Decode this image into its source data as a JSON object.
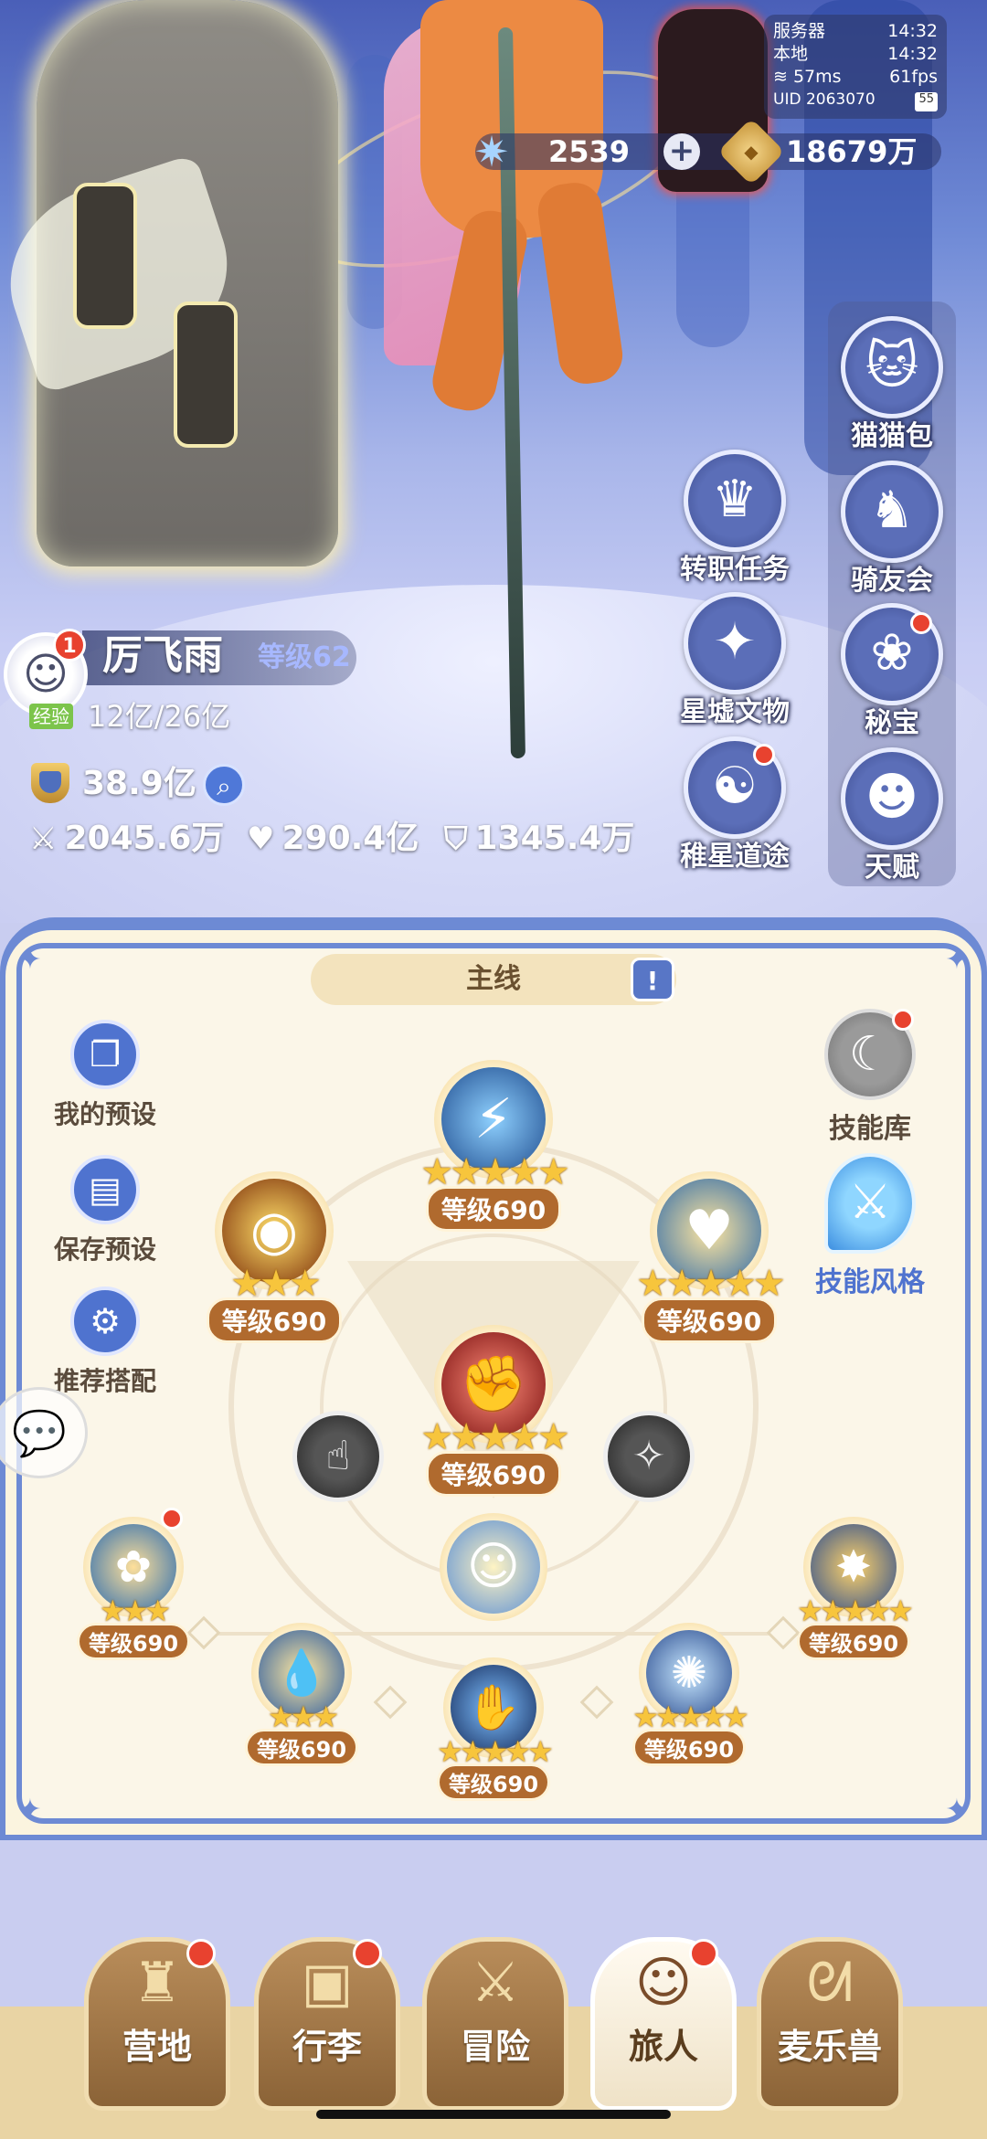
{
  "status": {
    "server_label": "服务器",
    "server_time": "14:32",
    "local_label": "本地",
    "local_time": "14:32",
    "ping": "57ms",
    "fps": "61fps",
    "uid": "UID 2063070",
    "battery": "55"
  },
  "currency": {
    "stars": "2539",
    "coins": "18679万"
  },
  "side_menu": [
    {
      "label": "猫猫包",
      "icon": "cat-bag-icon",
      "glyph": "🐱"
    },
    {
      "label": "转职任务",
      "icon": "class-change-icon",
      "glyph": "♛"
    },
    {
      "label": "骑友会",
      "icon": "horse-icon",
      "glyph": "♞"
    },
    {
      "label": "星墟文物",
      "icon": "relic-icon",
      "glyph": "✦"
    },
    {
      "label": "秘宝",
      "icon": "treasure-chest-icon",
      "glyph": "❀"
    },
    {
      "label": "稚星道途",
      "icon": "star-path-icon",
      "glyph": "☯"
    },
    {
      "label": "天赋",
      "icon": "talent-head-icon",
      "glyph": "☻"
    }
  ],
  "player": {
    "name": "厉飞雨",
    "level": "等级62",
    "badge": "1",
    "exp_label": "经验",
    "exp": "12亿/26亿",
    "power": "38.9亿",
    "attack": "2045.6万",
    "hp": "290.4亿",
    "defense": "1345.4万"
  },
  "panel": {
    "tab": "主线",
    "left_buttons": [
      {
        "label": "我的预设",
        "icon": "preset-icon",
        "glyph": "❐"
      },
      {
        "label": "保存预设",
        "icon": "save-icon",
        "glyph": "▤"
      },
      {
        "label": "推荐搭配",
        "icon": "recommend-icon",
        "glyph": "⚙"
      }
    ],
    "right_buttons": [
      {
        "label": "技能库",
        "icon": "skill-library-icon",
        "glyph": "☾"
      },
      {
        "label": "技能风格",
        "icon": "skill-style-icon",
        "glyph": "⚔"
      }
    ],
    "skills": {
      "top": {
        "level": "等级690",
        "stars": "★★★★★"
      },
      "upper_left": {
        "level": "等级690",
        "stars": "★★★"
      },
      "upper_right": {
        "level": "等级690",
        "stars": "★★★★★"
      },
      "center": {
        "level": "等级690",
        "stars": "★★★★★"
      },
      "far_left": {
        "level": "等级690",
        "stars": "★★★"
      },
      "far_right": {
        "level": "等级690",
        "stars": "★★★★★"
      },
      "bottom_left": {
        "level": "等级690",
        "stars": "★★★"
      },
      "bottom_mid": {
        "level": "等级690",
        "stars": "★★★★★"
      },
      "bottom_right": {
        "level": "等级690",
        "stars": "★★★★★"
      }
    }
  },
  "nav": [
    {
      "label": "营地",
      "icon": "camp-castle-icon",
      "glyph": "♜"
    },
    {
      "label": "行李",
      "icon": "luggage-icon",
      "glyph": "▣"
    },
    {
      "label": "冒险",
      "icon": "crossed-swords-icon",
      "glyph": "⚔"
    },
    {
      "label": "旅人",
      "icon": "traveler-avatar-icon",
      "glyph": "☺"
    },
    {
      "label": "麦乐兽",
      "icon": "pet-beast-icon",
      "glyph": "ᘛ"
    }
  ]
}
